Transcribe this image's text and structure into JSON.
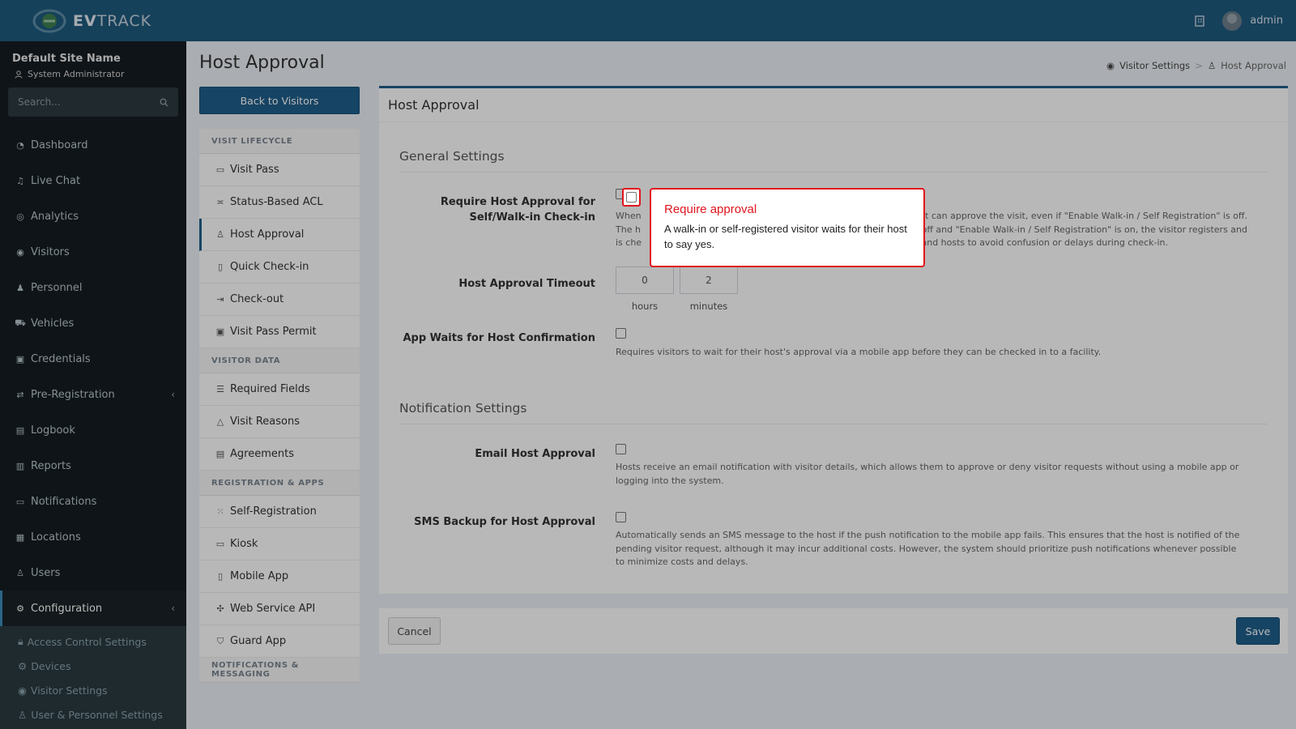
{
  "header": {
    "logo_text_bold": "EV",
    "logo_text_rest": "TRACK",
    "user_name": "admin",
    "building_icon": "building-icon"
  },
  "sidebar": {
    "site_name": "Default Site Name",
    "role": "System Administrator",
    "search_placeholder": "Search...",
    "items": [
      {
        "label": "Dashboard",
        "icon": "dashboard-icon"
      },
      {
        "label": "Live Chat",
        "icon": "headset-icon"
      },
      {
        "label": "Analytics",
        "icon": "target-icon"
      },
      {
        "label": "Visitors",
        "icon": "eye-icon"
      },
      {
        "label": "Personnel",
        "icon": "users-icon"
      },
      {
        "label": "Vehicles",
        "icon": "car-icon"
      },
      {
        "label": "Credentials",
        "icon": "id-card-icon"
      },
      {
        "label": "Pre-Registration",
        "icon": "arrows-icon"
      },
      {
        "label": "Logbook",
        "icon": "book-icon"
      },
      {
        "label": "Reports",
        "icon": "chart-icon"
      },
      {
        "label": "Notifications",
        "icon": "bell-icon"
      },
      {
        "label": "Locations",
        "icon": "building-icon"
      },
      {
        "label": "Users",
        "icon": "users-icon"
      },
      {
        "label": "Configuration",
        "icon": "gear-icon"
      }
    ],
    "sub_items": [
      {
        "label": "Access Control Settings",
        "icon": "lock-icon"
      },
      {
        "label": "Devices",
        "icon": "gear-icon"
      },
      {
        "label": "Visitor Settings",
        "icon": "eye-icon"
      },
      {
        "label": "User & Personnel Settings",
        "icon": "users-icon"
      }
    ]
  },
  "page": {
    "title": "Host Approval",
    "breadcrumb": [
      "Visitor Settings",
      "Host Approval"
    ],
    "back_button": "Back to Visitors"
  },
  "settings_menu": {
    "groups": [
      {
        "title": "VISIT LIFECYCLE",
        "items": [
          "Visit Pass",
          "Status-Based ACL",
          "Host Approval",
          "Quick Check-in",
          "Check-out",
          "Visit Pass Permit"
        ]
      },
      {
        "title": "VISITOR DATA",
        "items": [
          "Required Fields",
          "Visit Reasons",
          "Agreements"
        ]
      },
      {
        "title": "REGISTRATION & APPS",
        "items": [
          "Self-Registration",
          "Kiosk",
          "Mobile App",
          "Web Service API",
          "Guard App"
        ]
      },
      {
        "title": "NOTIFICATIONS & MESSAGING",
        "items": []
      }
    ]
  },
  "card": {
    "title": "Host Approval",
    "general_settings": "General Settings",
    "notification_settings": "Notification Settings",
    "fields": {
      "require_label": "Require Host Approval for Self/Walk-in Check-in",
      "require_help_1": "When",
      "require_help_1b": "o their host can approve the visit, even if \"Enable Walk-in / Self Registration\" is off.",
      "require_help_2": "The h",
      "require_help_2b": "hen this is off and \"Enable Walk-in / Self Registration\" is on, the visitor registers and",
      "require_help_3": "is che",
      "require_help_3b": "ent to visitors and hosts to avoid confusion or delays during check-in.",
      "timeout_label": "Host Approval Timeout",
      "timeout_hours": "0",
      "timeout_minutes": "2",
      "hours_unit": "hours",
      "minutes_unit": "minutes",
      "app_waits_label": "App Waits for Host Confirmation",
      "app_waits_help": "Requires visitors to wait for their host's approval via a mobile app before they can be checked in to a facility.",
      "email_label": "Email Host Approval",
      "email_help": "Hosts receive an email notification with visitor details, which allows them to approve or deny visitor requests without using a mobile app or logging into the system.",
      "sms_label": "SMS Backup for Host Approval",
      "sms_help": "Automatically sends an SMS message to the host if the push notification to the mobile app fails. This ensures that the host is notified of the pending visitor request, although it may incur additional costs. However, the system should prioritize push notifications whenever possible to minimize costs and delays."
    },
    "cancel": "Cancel",
    "save": "Save"
  },
  "popover": {
    "title": "Require approval",
    "text": "A walk-in or self-registered visitor waits for their host to say yes."
  },
  "colors": {
    "header": "#1f5a7f",
    "sidebar": "#161d22",
    "accent": "#1f5f8b",
    "highlight": "#e0151d"
  }
}
